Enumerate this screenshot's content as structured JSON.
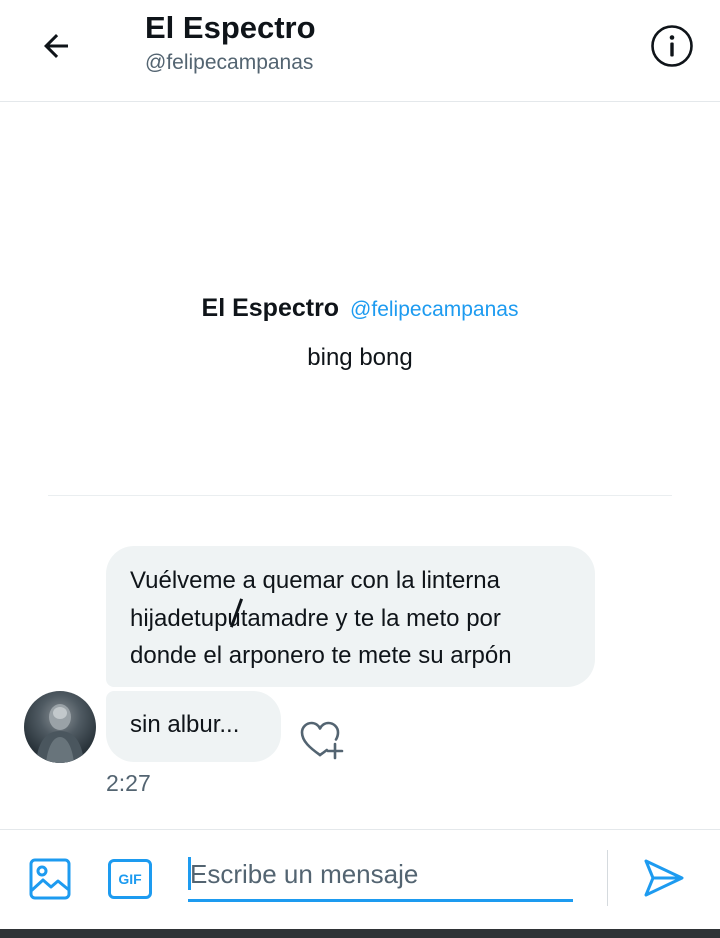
{
  "header": {
    "title": "El Espectro",
    "handle": "@felipecampanas",
    "back_icon": "arrow-left-icon",
    "info_icon": "info-circle-icon"
  },
  "profile": {
    "name": "El Espectro",
    "handle": "@felipecampanas",
    "bio": "bing bong"
  },
  "messages": [
    {
      "text_before": "Vuélveme a quemar con la linterna hijadetupu",
      "text_after": "tamadre y te la meto por donde el arponero te mete su arpón"
    },
    {
      "text": "sin albur..."
    }
  ],
  "timestamp": "2:27",
  "composer": {
    "placeholder": "Escribe un mensaje",
    "gif_label": "GIF",
    "media_icon": "image-icon",
    "send_icon": "send-icon"
  },
  "colors": {
    "accent": "#1d9bf0",
    "bubble_bg": "#eff3f4",
    "text_primary": "#0f1419",
    "text_secondary": "#536471"
  }
}
